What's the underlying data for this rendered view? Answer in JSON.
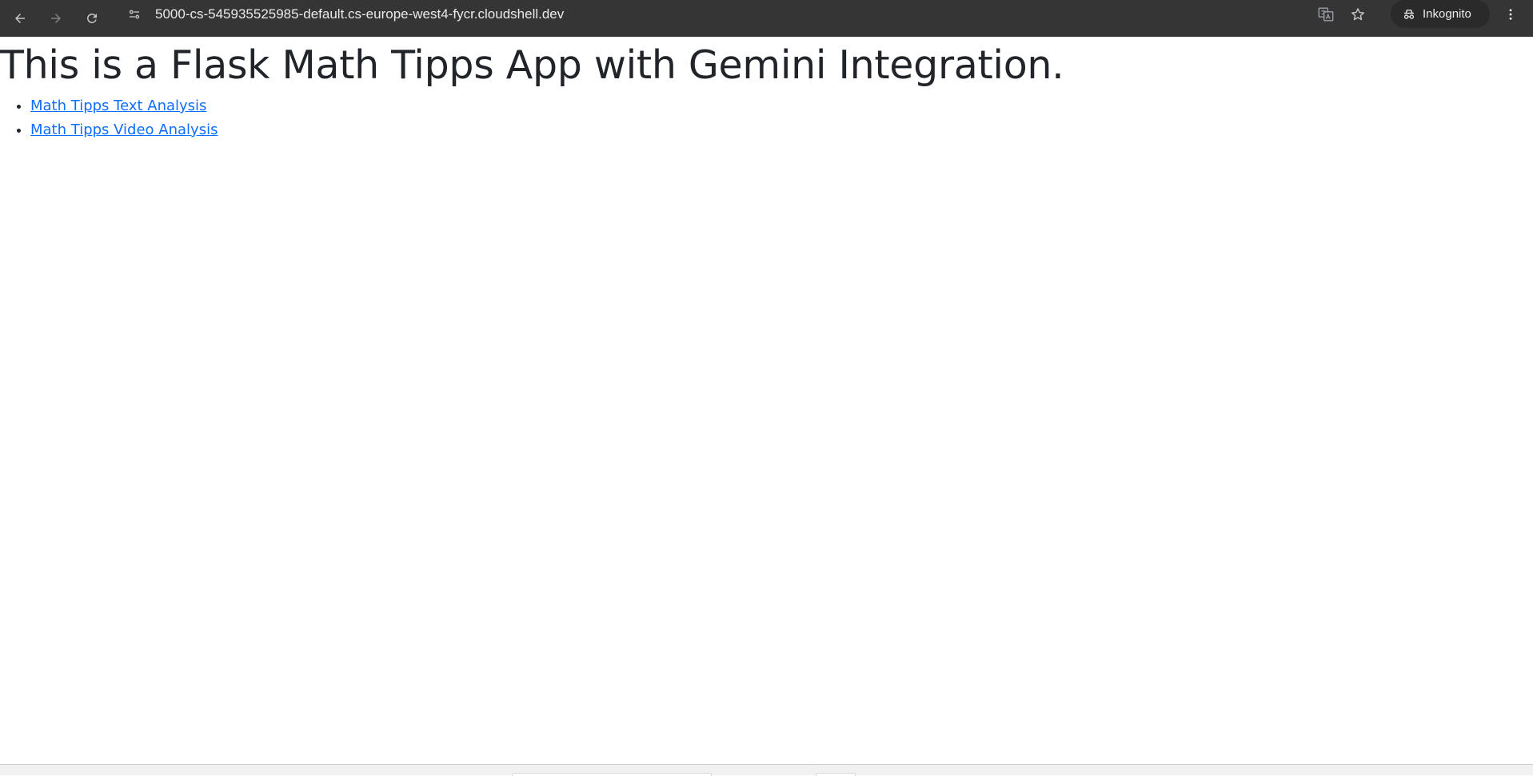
{
  "browser": {
    "url": "5000-cs-545935525985-default.cs-europe-west4-fycr.cloudshell.dev",
    "incognito_label": "Inkognito",
    "icons": {
      "back": "arrow-left-icon",
      "forward": "arrow-right-icon",
      "reload": "reload-icon",
      "site_info": "tune-icon",
      "translate": "translate-icon",
      "bookmark": "star-icon",
      "incognito": "incognito-icon",
      "menu": "kebab-menu-icon"
    },
    "colors": {
      "toolbar": "#353535",
      "text": "#e8eaed"
    }
  },
  "page": {
    "title": "This is a Flask Math Tipps App with Gemini Integration.",
    "links": [
      {
        "label": "Math Tipps Text Analysis"
      },
      {
        "label": "Math Tipps Video Analysis"
      }
    ],
    "colors": {
      "heading": "#212529",
      "link": "#0d6efd"
    }
  }
}
